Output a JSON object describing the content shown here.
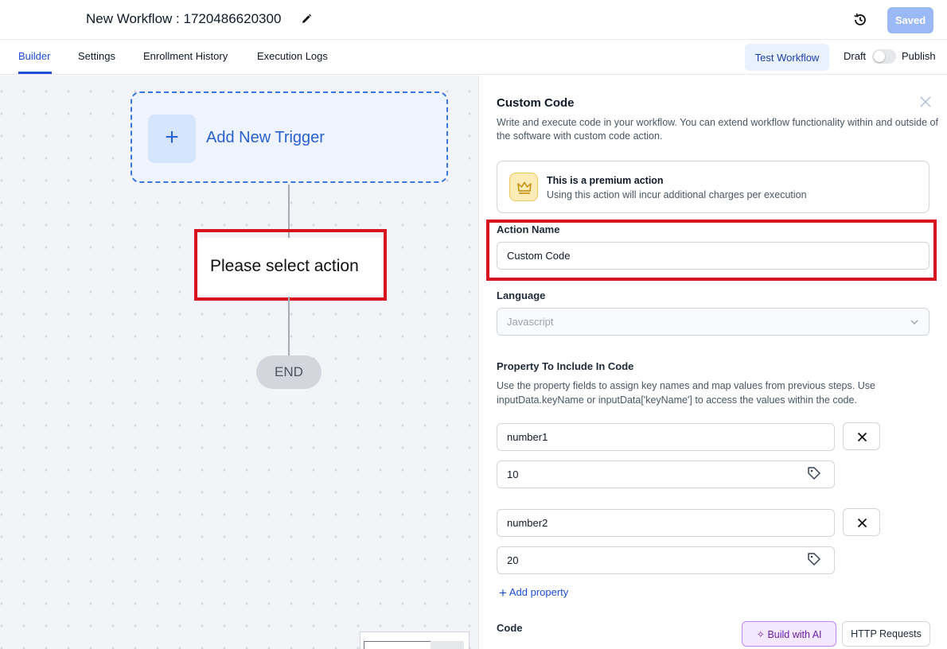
{
  "header": {
    "workflow_title": "New Workflow : 1720486620300",
    "saved_label": "Saved"
  },
  "tabs": [
    {
      "label": "Builder",
      "active": true
    },
    {
      "label": "Settings",
      "active": false
    },
    {
      "label": "Enrollment History",
      "active": false
    },
    {
      "label": "Execution Logs",
      "active": false
    }
  ],
  "toolbar": {
    "test_workflow_label": "Test Workflow",
    "draft_label": "Draft",
    "publish_label": "Publish",
    "publish_toggle_on": false
  },
  "canvas": {
    "trigger_label": "Add New Trigger",
    "trigger_icon": "plus-icon",
    "action_label": "Please select action",
    "end_label": "END"
  },
  "panel": {
    "title": "Custom Code",
    "description": "Write and execute code in your workflow. You can extend workflow functionality within and outside of the software with custom code action.",
    "premium_title": "This is a premium action",
    "premium_subtitle": "Using this action will incur additional charges per execution",
    "action_name_label": "Action Name",
    "action_name_value": "Custom Code",
    "language_label": "Language",
    "language_value": "Javascript",
    "property_label": "Property To Include In Code",
    "property_description": "Use the property fields to assign key names and map values from previous steps. Use inputData.keyName or inputData['keyName'] to access the values within the code.",
    "properties": [
      {
        "key": "number1",
        "value": "10"
      },
      {
        "key": "number2",
        "value": "20"
      }
    ],
    "add_property_label": "Add property",
    "code_label": "Code",
    "build_ai_label": "Build with AI",
    "http_requests_label": "HTTP Requests"
  },
  "colors": {
    "accent": "#1d4ed8",
    "highlight_box": "#d7141d",
    "saved_button": "#9bb8f7"
  }
}
